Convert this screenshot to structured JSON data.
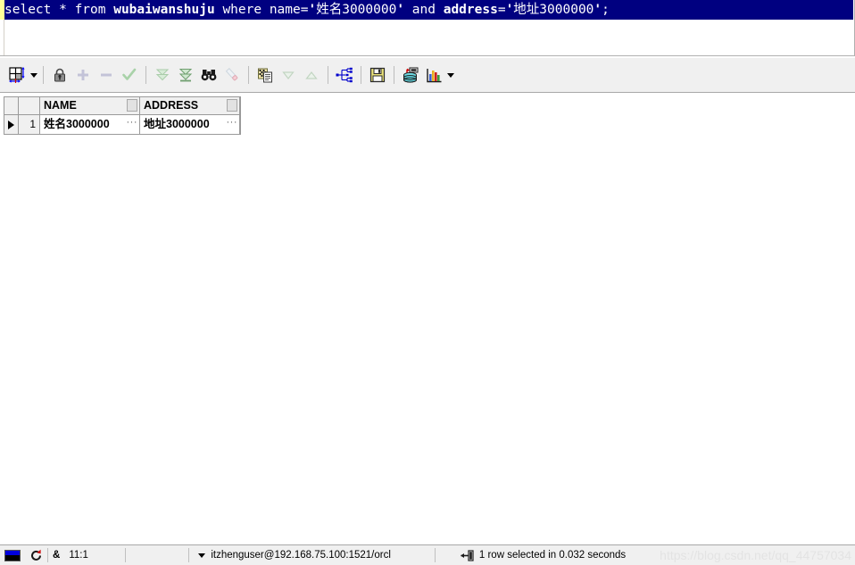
{
  "editor": {
    "sql_parts": [
      {
        "text": "select * from ",
        "bold": false
      },
      {
        "text": "wubaiwanshuju",
        "bold": true
      },
      {
        "text": " where name=",
        "bold": false
      },
      {
        "text": "'",
        "bold": true
      },
      {
        "text": "姓名3000000",
        "bold": false
      },
      {
        "text": "'",
        "bold": true
      },
      {
        "text": " and ",
        "bold": false
      },
      {
        "text": "address",
        "bold": true
      },
      {
        "text": "=",
        "bold": false
      },
      {
        "text": "'",
        "bold": true
      },
      {
        "text": "地址3000000",
        "bold": false
      },
      {
        "text": "'",
        "bold": true
      },
      {
        "text": ";",
        "bold": false
      }
    ],
    "sql_plain": "select * from wubaiwanshuju where name='姓名3000000' and address='地址3000000';",
    "selection_color": "#000080",
    "selection_text_color": "#ffffff",
    "bookmark_gutter_color": "#ffff99"
  },
  "toolbar": {
    "items": [
      {
        "name": "grid-layout-icon",
        "label": "Grid Layout",
        "enabled": true,
        "has_caret": true
      },
      {
        "name": "lock-icon",
        "label": "Lock Record",
        "enabled": true,
        "has_caret": false
      },
      {
        "name": "plus-icon",
        "label": "Insert Record",
        "enabled": false,
        "has_caret": false
      },
      {
        "name": "minus-icon",
        "label": "Delete Record",
        "enabled": false,
        "has_caret": false
      },
      {
        "name": "check-icon",
        "label": "Post Changes",
        "enabled": false,
        "has_caret": false
      },
      {
        "name": "fetch-next-page-icon",
        "label": "Fetch Next Page",
        "enabled": false,
        "has_caret": false
      },
      {
        "name": "fetch-last-page-icon",
        "label": "Fetch Last Page",
        "enabled": true,
        "has_caret": false
      },
      {
        "name": "binoculars-icon",
        "label": "Find Data",
        "enabled": true,
        "has_caret": false
      },
      {
        "name": "eraser-icon",
        "label": "Clear Filter",
        "enabled": false,
        "has_caret": false
      },
      {
        "name": "copy-pages-icon",
        "label": "Copy To Clipboard",
        "enabled": true,
        "has_caret": false
      },
      {
        "name": "sort-descending-icon",
        "label": "Sort Descending",
        "enabled": false,
        "has_caret": false
      },
      {
        "name": "sort-ascending-icon",
        "label": "Sort Ascending",
        "enabled": false,
        "has_caret": false
      },
      {
        "name": "hierarchy-icon",
        "label": "Explain Plan",
        "enabled": true,
        "has_caret": false
      },
      {
        "name": "save-floppy-icon",
        "label": "Export Results",
        "enabled": true,
        "has_caret": false
      },
      {
        "name": "database-export-icon",
        "label": "Data To Database",
        "enabled": true,
        "has_caret": false
      },
      {
        "name": "bar-chart-icon",
        "label": "Chart",
        "enabled": true,
        "has_caret": true
      }
    ]
  },
  "grid": {
    "columns": [
      "NAME",
      "ADDRESS"
    ],
    "rows": [
      {
        "number": "1",
        "NAME": "姓名3000000",
        "ADDRESS": "地址3000000"
      }
    ],
    "ellipsis_label": "···"
  },
  "statusbar": {
    "position": "11:1",
    "ampersand": "&",
    "connection": "itzhenguser@192.168.75.100:1521/orcl",
    "result_message": "1 row selected in 0.032 seconds",
    "watermark": "https://blog.csdn.net/qq_44757034"
  }
}
